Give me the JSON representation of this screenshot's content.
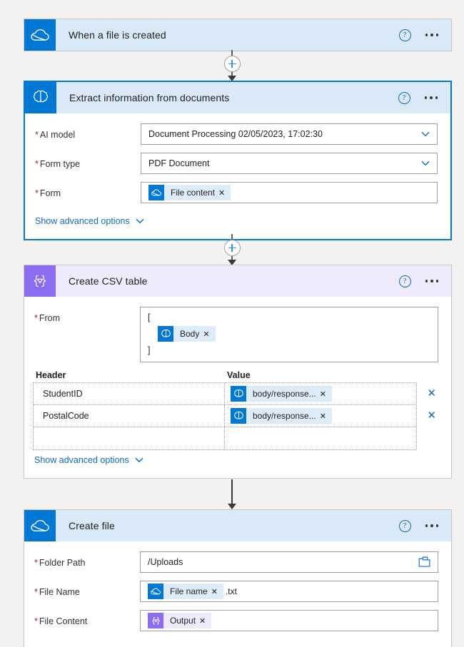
{
  "flow": {
    "steps": [
      {
        "id": "trigger",
        "title": "When a file is created",
        "icon": "onedrive-cloud-icon",
        "accent": "#0078d4",
        "header_bg": "#d9e9f7",
        "selected": false,
        "expanded": false
      },
      {
        "id": "extract",
        "title": "Extract information from documents",
        "icon": "ai-builder-brain-icon",
        "accent": "#0078d4",
        "header_bg": "#d9e9f7",
        "selected": true,
        "expanded": true,
        "fields": [
          {
            "label": "AI model",
            "required": true,
            "type": "dropdown",
            "value": "Document Processing 02/05/2023, 17:02:30"
          },
          {
            "label": "Form type",
            "required": true,
            "type": "dropdown",
            "value": "PDF Document"
          },
          {
            "label": "Form",
            "required": true,
            "type": "token",
            "token": {
              "text": "File content",
              "icon": "onedrive-cloud-icon",
              "color": "blue"
            }
          }
        ],
        "advanced_label": "Show advanced options"
      },
      {
        "id": "createcsv",
        "title": "Create CSV table",
        "icon": "data-operations-icon",
        "accent": "#8c6cf0",
        "header_bg": "#efebfd",
        "selected": false,
        "expanded": true,
        "from_label": "From",
        "from_required": true,
        "from_open_bracket": "[",
        "from_close_bracket": "]",
        "from_token": {
          "text": "Body",
          "icon": "ai-builder-brain-icon",
          "color": "blue"
        },
        "table": {
          "columns": [
            "Header",
            "Value"
          ],
          "rows": [
            {
              "header": "StudentID",
              "value": "body/response...",
              "value_icon": "ai-builder-brain-icon"
            },
            {
              "header": "PostalCode",
              "value": "body/response...",
              "value_icon": "ai-builder-brain-icon"
            },
            {
              "header": "",
              "value": "",
              "value_icon": ""
            }
          ],
          "delete_glyph": "✕"
        },
        "advanced_label": "Show advanced options"
      },
      {
        "id": "createfile",
        "title": "Create file",
        "icon": "onedrive-cloud-icon",
        "accent": "#0078d4",
        "header_bg": "#d9e9f7",
        "selected": false,
        "expanded": true,
        "fields": [
          {
            "label": "Folder Path",
            "required": true,
            "type": "text-with-picker",
            "value": "/Uploads",
            "picker_icon": "folder-icon"
          },
          {
            "label": "File Name",
            "required": true,
            "type": "token-with-suffix",
            "token": {
              "text": "File name",
              "icon": "onedrive-cloud-icon",
              "color": "blue"
            },
            "suffix": ".txt"
          },
          {
            "label": "File Content",
            "required": true,
            "type": "token",
            "token": {
              "text": "Output",
              "icon": "data-operations-icon",
              "color": "purple"
            }
          }
        ]
      }
    ],
    "connectors": [
      {
        "id": "conn-1",
        "has_plus": true,
        "plus_label": "+"
      },
      {
        "id": "conn-2",
        "has_plus": true,
        "plus_label": "+"
      },
      {
        "id": "conn-3",
        "has_plus": false,
        "plus_label": ""
      }
    ],
    "header_actions": {
      "help": "?",
      "menu": "···"
    },
    "token_remove_glyph": "✕",
    "required_marker": "*"
  }
}
